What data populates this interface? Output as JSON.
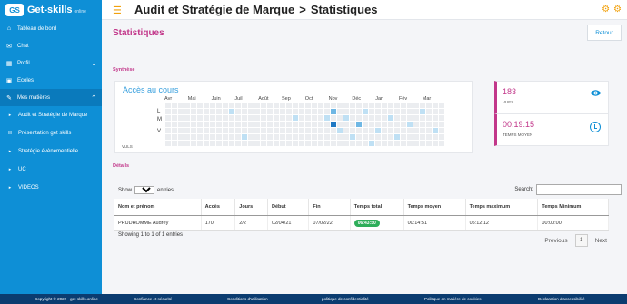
{
  "brand": {
    "name": "Get-skills",
    "sub": "online",
    "mark": "GS"
  },
  "header": {
    "title": "Audit et Stratégie de Marque",
    "separator": ">",
    "subtitle": "Statistiques"
  },
  "sidebar": {
    "items": [
      {
        "label": "Tableau de bord",
        "icon": "dashboard-icon",
        "glyph": "⌂"
      },
      {
        "label": "Chat",
        "icon": "chat-icon",
        "glyph": "✉"
      },
      {
        "label": "Profil",
        "icon": "profile-icon",
        "glyph": "▦"
      },
      {
        "label": "Ecoles",
        "icon": "school-icon",
        "glyph": "▣"
      },
      {
        "label": "Mes matières",
        "icon": "edit-icon",
        "glyph": "✎"
      }
    ],
    "subitems": [
      {
        "label": "Audit et Stratégie de Marque",
        "glyph": "▸"
      },
      {
        "label": "Présentation get skills",
        "glyph": "☷"
      },
      {
        "label": "Stratégie évènementielle",
        "glyph": "▸"
      },
      {
        "label": "UC",
        "glyph": "▸"
      },
      {
        "label": "VIDEOS",
        "glyph": "▸"
      }
    ]
  },
  "main": {
    "title": "Statistiques",
    "back_label": "Retour",
    "synthese_label": "Synthèse",
    "details_label": "Détails"
  },
  "heatmap": {
    "title": "Accès au cours",
    "months": [
      "Avr",
      "Mai",
      "Juin",
      "Juil",
      "Août",
      "Sep",
      "Oct",
      "Nov",
      "Déc",
      "Jan",
      "Fév",
      "Mar"
    ],
    "days": [
      "L",
      "M",
      "V"
    ],
    "footer": "VULS",
    "activity": [
      {
        "col": 26,
        "row": 3,
        "level": 3
      },
      {
        "col": 26,
        "row": 1,
        "level": 2
      },
      {
        "col": 25,
        "row": 2,
        "level": 1
      },
      {
        "col": 27,
        "row": 4,
        "level": 1
      },
      {
        "col": 28,
        "row": 2,
        "level": 1
      },
      {
        "col": 29,
        "row": 5,
        "level": 1
      },
      {
        "col": 30,
        "row": 3,
        "level": 2
      },
      {
        "col": 31,
        "row": 1,
        "level": 1
      },
      {
        "col": 32,
        "row": 6,
        "level": 1
      },
      {
        "col": 33,
        "row": 4,
        "level": 1
      },
      {
        "col": 35,
        "row": 2,
        "level": 1
      },
      {
        "col": 36,
        "row": 5,
        "level": 1
      },
      {
        "col": 38,
        "row": 3,
        "level": 1
      },
      {
        "col": 40,
        "row": 1,
        "level": 1
      },
      {
        "col": 42,
        "row": 4,
        "level": 1
      },
      {
        "col": 12,
        "row": 5,
        "level": 1
      },
      {
        "col": 20,
        "row": 2,
        "level": 1
      },
      {
        "col": 10,
        "row": 1,
        "level": 1
      }
    ],
    "levels": [
      "#ebedf0",
      "#bfe0f4",
      "#6fb7e4",
      "#1f79c4"
    ]
  },
  "cards": [
    {
      "value": "183",
      "label": "VUES",
      "icon": "eye-icon"
    },
    {
      "value": "00:19:15",
      "label": "TEMPS MOYEN",
      "icon": "clock-icon"
    }
  ],
  "table": {
    "show_label": "Show",
    "entries_label": "entries",
    "show_value": "10",
    "search_label": "Search:",
    "columns": [
      "Nom et prénom",
      "Accès",
      "Jours",
      "Début",
      "Fin",
      "Temps total",
      "Temps moyen",
      "Temps maximum",
      "Temps Minimum"
    ],
    "rows": [
      [
        "PRUDHOMME Audrey",
        "170",
        "2/2",
        "02/04/21",
        "07/02/22",
        "06:43:50",
        "00:14:51",
        "05:12:12",
        "00:00:00"
      ]
    ],
    "info": "Showing 1 to 1 of 1 entries",
    "prev": "Previous",
    "page": "1",
    "next": "Next"
  },
  "footer": {
    "items": [
      "Copyright © 2022 - get-skills.online",
      "Confiance et sécurité",
      "Conditions d'utilisation",
      "politique de confidentialité",
      "Politique en matière de cookies",
      "Déclaration d'accessibilité"
    ]
  },
  "colors": {
    "brand": "#0e8fd6",
    "accent": "#c2378a",
    "warn": "#f1a10d",
    "success": "#2eae5a"
  }
}
